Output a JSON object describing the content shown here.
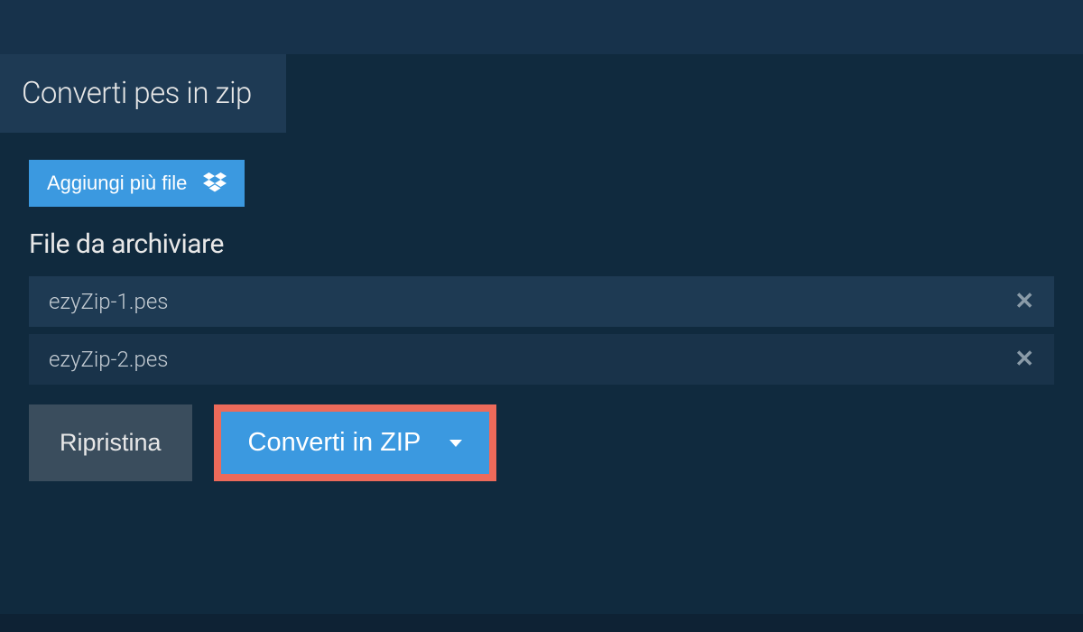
{
  "tab": {
    "title": "Converti pes in zip"
  },
  "addButton": {
    "label": "Aggiungi più file"
  },
  "section": {
    "heading": "File da archiviare"
  },
  "files": [
    {
      "name": "ezyZip-1.pes"
    },
    {
      "name": "ezyZip-2.pes"
    }
  ],
  "actions": {
    "reset": "Ripristina",
    "convert": "Converti in ZIP"
  }
}
